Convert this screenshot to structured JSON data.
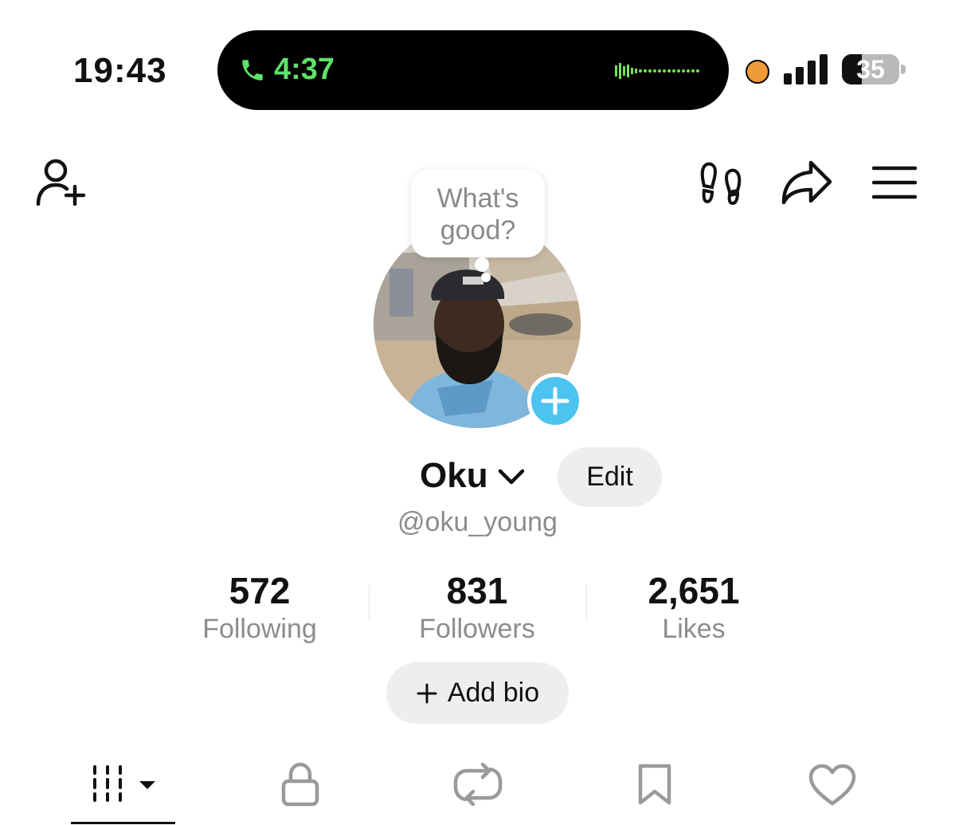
{
  "status_bar": {
    "time": "19:43",
    "call_duration": "4:37",
    "battery_level": "35",
    "battery_fraction": 0.35,
    "icons": [
      "phone-icon",
      "waveform-icon",
      "recording-dot-icon",
      "signal-icon",
      "battery-icon"
    ]
  },
  "toolbar": {
    "left_icon": "add-friend-icon",
    "right_icons": [
      "footprints-icon",
      "share-icon",
      "menu-icon"
    ]
  },
  "profile": {
    "note_bubble": "What's good?",
    "name": "Oku",
    "handle": "@oku_young",
    "edit_label": "Edit",
    "add_bio_label": "Add bio"
  },
  "stats": [
    {
      "value": "572",
      "label": "Following"
    },
    {
      "value": "831",
      "label": "Followers"
    },
    {
      "value": "2,651",
      "label": "Likes"
    }
  ],
  "tabs": [
    {
      "name": "videos",
      "icon": "grid-icon",
      "active": true
    },
    {
      "name": "private",
      "icon": "lock-icon",
      "active": false
    },
    {
      "name": "reposts",
      "icon": "repost-icon",
      "active": false
    },
    {
      "name": "favorites",
      "icon": "bookmark-icon",
      "active": false
    },
    {
      "name": "liked",
      "icon": "heart-icon",
      "active": false
    }
  ],
  "colors": {
    "accent_blue": "#4cc3f0",
    "call_green": "#5fe06a",
    "recording_orange": "#f09a3a",
    "muted_text": "#8c8c8c"
  }
}
